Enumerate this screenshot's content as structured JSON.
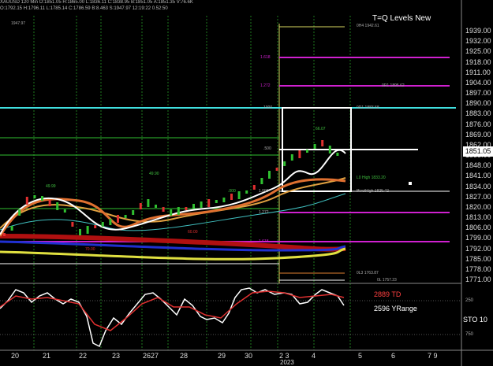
{
  "header": {
    "text": "XAUUSD 120 Min  O:1851.05  H:1865.00  L:1836.11  C:1838.95  B:1851.05  A:1851.35  V:76.6K",
    "sub": "O:1792.15 H:1796.11 L:1785.14 C:1786.59 B:8.463 S:1947.97 12:19:22 0.52:50",
    "top_left_value": "1947.97"
  },
  "title": "T=Q Levels New",
  "price_axis": [
    "1939.00",
    "1932.00",
    "1925.00",
    "1918.00",
    "1911.00",
    "1904.00",
    "1897.00",
    "1890.00",
    "1883.00",
    "1876.00",
    "1869.00",
    "1862.00",
    "1855.00",
    "1848.00",
    "1841.00",
    "1834.00",
    "1827.00",
    "1820.00",
    "1813.00",
    "1806.00",
    "1799.00",
    "1792.00",
    "1785.00",
    "1778.00",
    "1771.00"
  ],
  "current_price": "1851.05",
  "x_axis": [
    "20",
    "21",
    "22",
    "23",
    "2627",
    "28",
    "29",
    "30",
    "2 3",
    "4",
    "5",
    "6",
    "7 9"
  ],
  "x_year": "2023",
  "level_labels": {
    "l1": "0H4 1942.61",
    "l2": "1.618",
    "l3": "1.272",
    "l4": "0R1 1895.62",
    "l5": "1000",
    "l6": "0R1 1883.58",
    "l7": ".500",
    "l8": "L0 High 1833.20",
    "l9": "1.000",
    "l10": "PivotHigh 1825.42",
    "l11": "1.272",
    "l12": "1.618",
    "l13": "0L3 1763.87",
    "l14": "0L 1757.23"
  },
  "annotations": {
    "a1": "49.99",
    "a2": "49.90",
    "a3": ".000",
    "a4": "66.07",
    "a5": "70.00",
    "a6": "60.00"
  },
  "indicator": {
    "td": "2889 TD",
    "yrange": "2596 YRange",
    "sto": "STO 10",
    "lvl1": "250",
    "lvl2": "750"
  },
  "colors": {
    "level_magenta": "#d020d0",
    "level_cyan": "#40e0e0",
    "level_green": "#30c030",
    "box": "#ffffff",
    "sto_white": "#ffffff",
    "sto_red": "#e03030"
  }
}
